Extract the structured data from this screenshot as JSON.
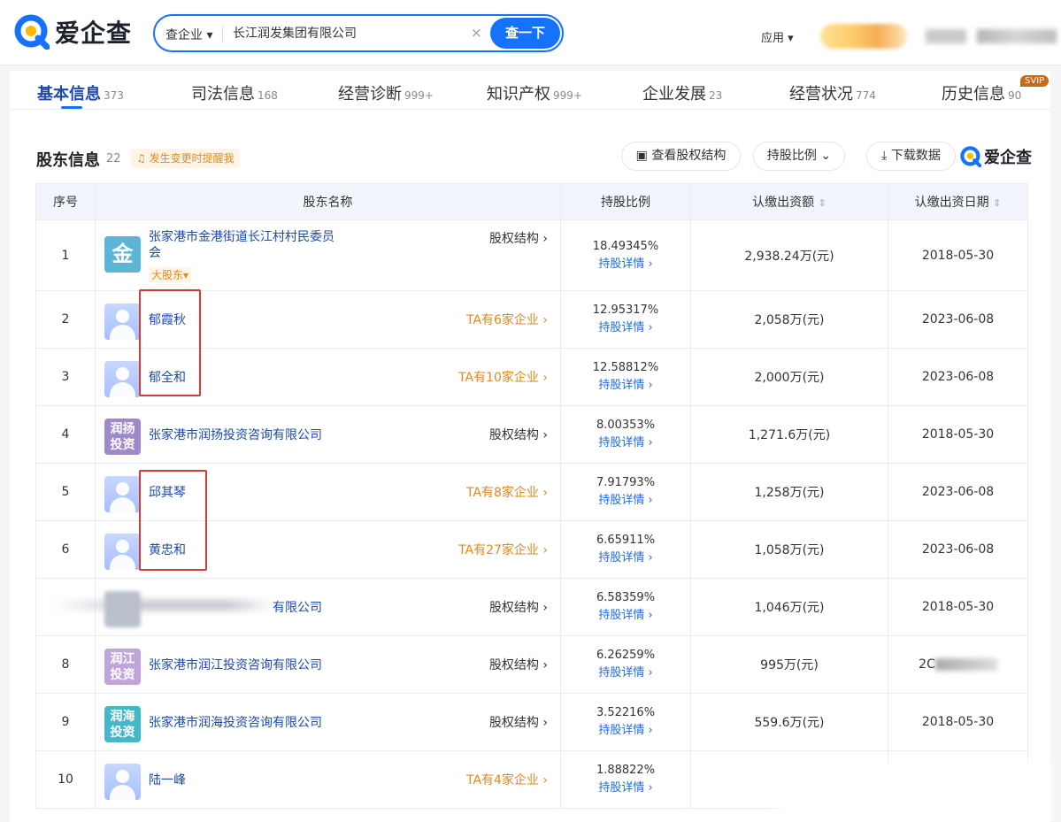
{
  "header": {
    "logo_text": "爱企查",
    "search_type": "查企业",
    "search_value": "长江润发集团有限公司",
    "search_button": "查一下",
    "apps_label": "应用"
  },
  "tabs": [
    {
      "label": "基本信息",
      "count": "373"
    },
    {
      "label": "司法信息",
      "count": "168"
    },
    {
      "label": "经营诊断",
      "count": "999+"
    },
    {
      "label": "知识产权",
      "count": "999+"
    },
    {
      "label": "企业发展",
      "count": "23"
    },
    {
      "label": "经营状况",
      "count": "774"
    },
    {
      "label": "历史信息",
      "count": "90"
    }
  ],
  "svip_badge": "SVIP",
  "section": {
    "title": "股东信息",
    "count": "22",
    "remind": "发生变更时提醒我",
    "btn_structure": "查看股权结构",
    "btn_ratio": "持股比例",
    "btn_download": "下载数据",
    "brand": "爱企查"
  },
  "table": {
    "headers": {
      "no": "序号",
      "name": "股东名称",
      "ratio": "持股比例",
      "capital": "认缴出资额",
      "date": "认缴出资日期"
    },
    "detail_label": "持股详情",
    "rows": [
      {
        "no": "1",
        "name": "张家港市金港街道长江村村民委员会",
        "avatar_text": "金",
        "tag": "大股东",
        "link": "股权结构",
        "ratio": "18.49345%",
        "capital": "2,938.24万(元)",
        "date": "2018-05-30"
      },
      {
        "no": "2",
        "name": "郁霞秋",
        "link": "TA有6家企业",
        "ratio": "12.95317%",
        "capital": "2,058万(元)",
        "date": "2023-06-08"
      },
      {
        "no": "3",
        "name": "郁全和",
        "link": "TA有10家企业",
        "ratio": "12.58812%",
        "capital": "2,000万(元)",
        "date": "2023-06-08"
      },
      {
        "no": "4",
        "name": "张家港市润扬投资咨询有限公司",
        "avatar_text": "润扬投资",
        "link": "股权结构",
        "ratio": "8.00353%",
        "capital": "1,271.6万(元)",
        "date": "2018-05-30"
      },
      {
        "no": "5",
        "name": "邱其琴",
        "link": "TA有8家企业",
        "ratio": "7.91793%",
        "capital": "1,258万(元)",
        "date": "2023-06-08"
      },
      {
        "no": "6",
        "name": "黄忠和",
        "link": "TA有27家企业",
        "ratio": "6.65911%",
        "capital": "1,058万(元)",
        "date": "2023-06-08"
      },
      {
        "no": "",
        "name": "有限公司",
        "link": "股权结构",
        "ratio": "6.58359%",
        "capital": "1,046万(元)",
        "date": "2018-05-30"
      },
      {
        "no": "8",
        "name": "张家港市润江投资咨询有限公司",
        "avatar_text": "润江投资",
        "link": "股权结构",
        "ratio": "6.26259%",
        "capital": "995万(元)",
        "date": "2C"
      },
      {
        "no": "9",
        "name": "张家港市润海投资咨询有限公司",
        "avatar_text": "润海投资",
        "link": "股权结构",
        "ratio": "3.52216%",
        "capital": "559.6万(元)",
        "date": "2018-05-30"
      },
      {
        "no": "10",
        "name": "陆一峰",
        "link": "TA有4家企业",
        "ratio": "1.88822%",
        "capital": "",
        "date": ""
      }
    ]
  },
  "colors": {
    "brand_blue": "#1572ff",
    "link_blue": "#1e4aa8",
    "orange": "#e08a1e",
    "highlight_red": "#d23b36"
  }
}
